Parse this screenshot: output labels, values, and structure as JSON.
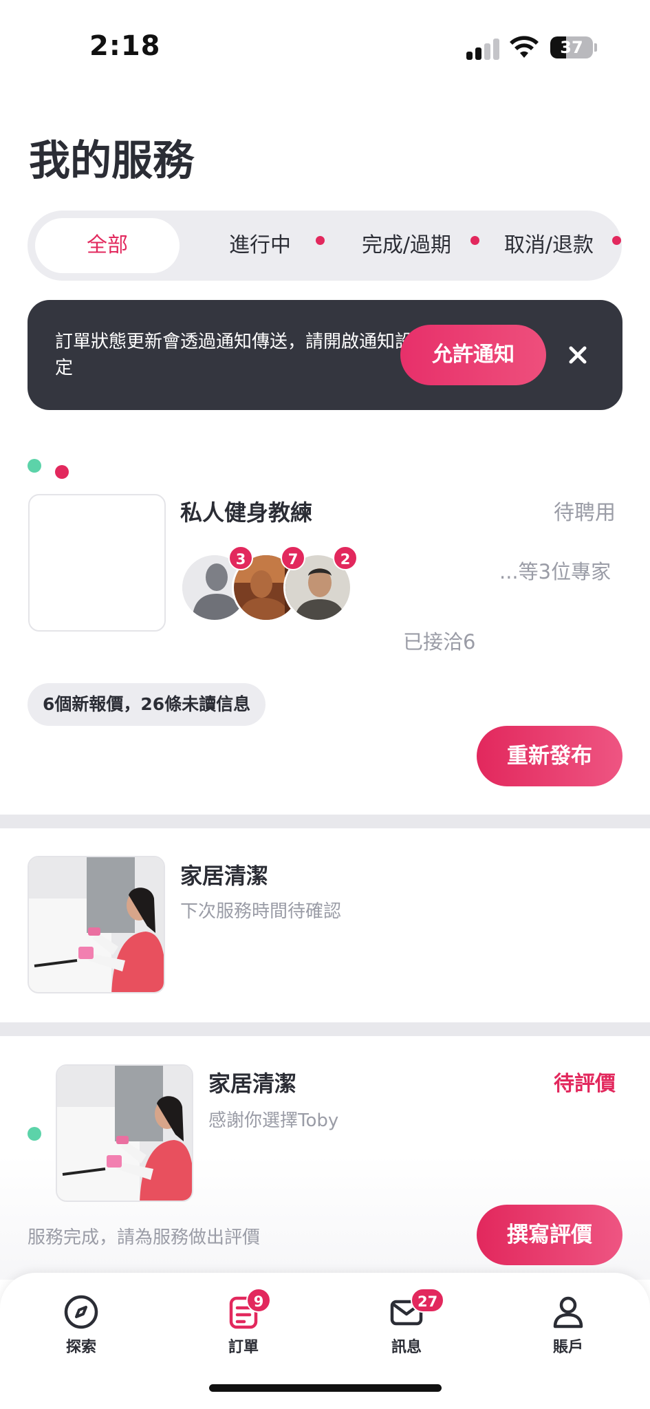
{
  "status_bar": {
    "time": "2:18",
    "battery": "37",
    "battery_level": 0.37
  },
  "page_title": "我的服務",
  "tabs": [
    {
      "label": "全部",
      "active": true,
      "dot": false
    },
    {
      "label": "進行中",
      "active": false,
      "dot": true
    },
    {
      "label": "完成/過期",
      "active": false,
      "dot": true
    },
    {
      "label": "取消/退款",
      "active": false,
      "dot": true
    }
  ],
  "notice": {
    "text": "訂單狀態更新會透過通知傳送，請開啟通知設定",
    "button": "允許通知",
    "close_icon": "close-icon"
  },
  "orders": [
    {
      "title": "私人健身教練",
      "status": "待聘用",
      "avatar_badges": [
        "3",
        "7",
        "2"
      ],
      "experts_text": "...等3位專家",
      "contacted": "已接洽6",
      "info_pill": "6個新報價，26條未讀信息",
      "button": "重新發布"
    },
    {
      "title": "家居清潔",
      "subtitle": "下次服務時間待確認"
    },
    {
      "title": "家居清潔",
      "subtitle": "感謝你選擇Toby",
      "status": "待評價",
      "footer_text": "服務完成，請為服務做出評價",
      "button": "撰寫評價"
    }
  ],
  "nav": [
    {
      "label": "探索",
      "icon": "compass-icon",
      "badge": ""
    },
    {
      "label": "訂單",
      "icon": "order-icon",
      "badge": "9"
    },
    {
      "label": "訊息",
      "icon": "mail-icon",
      "badge": "27"
    },
    {
      "label": "賬戶",
      "icon": "user-icon",
      "badge": ""
    }
  ],
  "colors": {
    "accent": "#e2285d",
    "dark": "#34363f",
    "green_dot": "#5cd3a9"
  }
}
